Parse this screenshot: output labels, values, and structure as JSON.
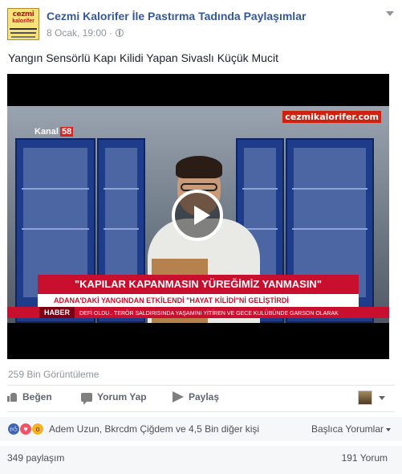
{
  "post": {
    "page_name": "Cezmi Kalorifer İle Pastırma Tadında Paylaşımlar",
    "logo_text": "cezmi kalorifer",
    "timestamp": "8 Ocak, 19:00 ·",
    "text": "Yangın Sensörlü Kapı Kilidi Yapan Sivaslı Küçük Mucit"
  },
  "video": {
    "channel": "Kanal",
    "channel_number": "58",
    "watermark": "cezmikalorifer.com",
    "headline": "\"KAPILAR KAPANMASIN YÜREĞİMİZ YANMASIN\"",
    "subheadline": "ADANA'DAKİ YANGINDAN ETKİLENDİ \"HAYAT KİLİDİ\"Nİ GELİŞTİRDİ",
    "ticker_label": "HABER",
    "ticker_text": "DEFİ OLDU.. TERÖR SALDIRISINDA YAŞAMINI YİTİREN VE GECE KULÜBÜNDE GARSON OLARAK"
  },
  "stats": {
    "views": "259 Bin Görüntüleme"
  },
  "actions": {
    "like": "Beğen",
    "comment": "Yorum Yap",
    "share": "Paylaş"
  },
  "reactions": {
    "text": "Adem Uzun, Bkrcdm Çiğdem ve 4,5 Bin diğer kişi",
    "sort_label": "Başlıca Yorumlar"
  },
  "counts": {
    "shares": "349 paylaşım",
    "comments": "191 Yorum"
  }
}
